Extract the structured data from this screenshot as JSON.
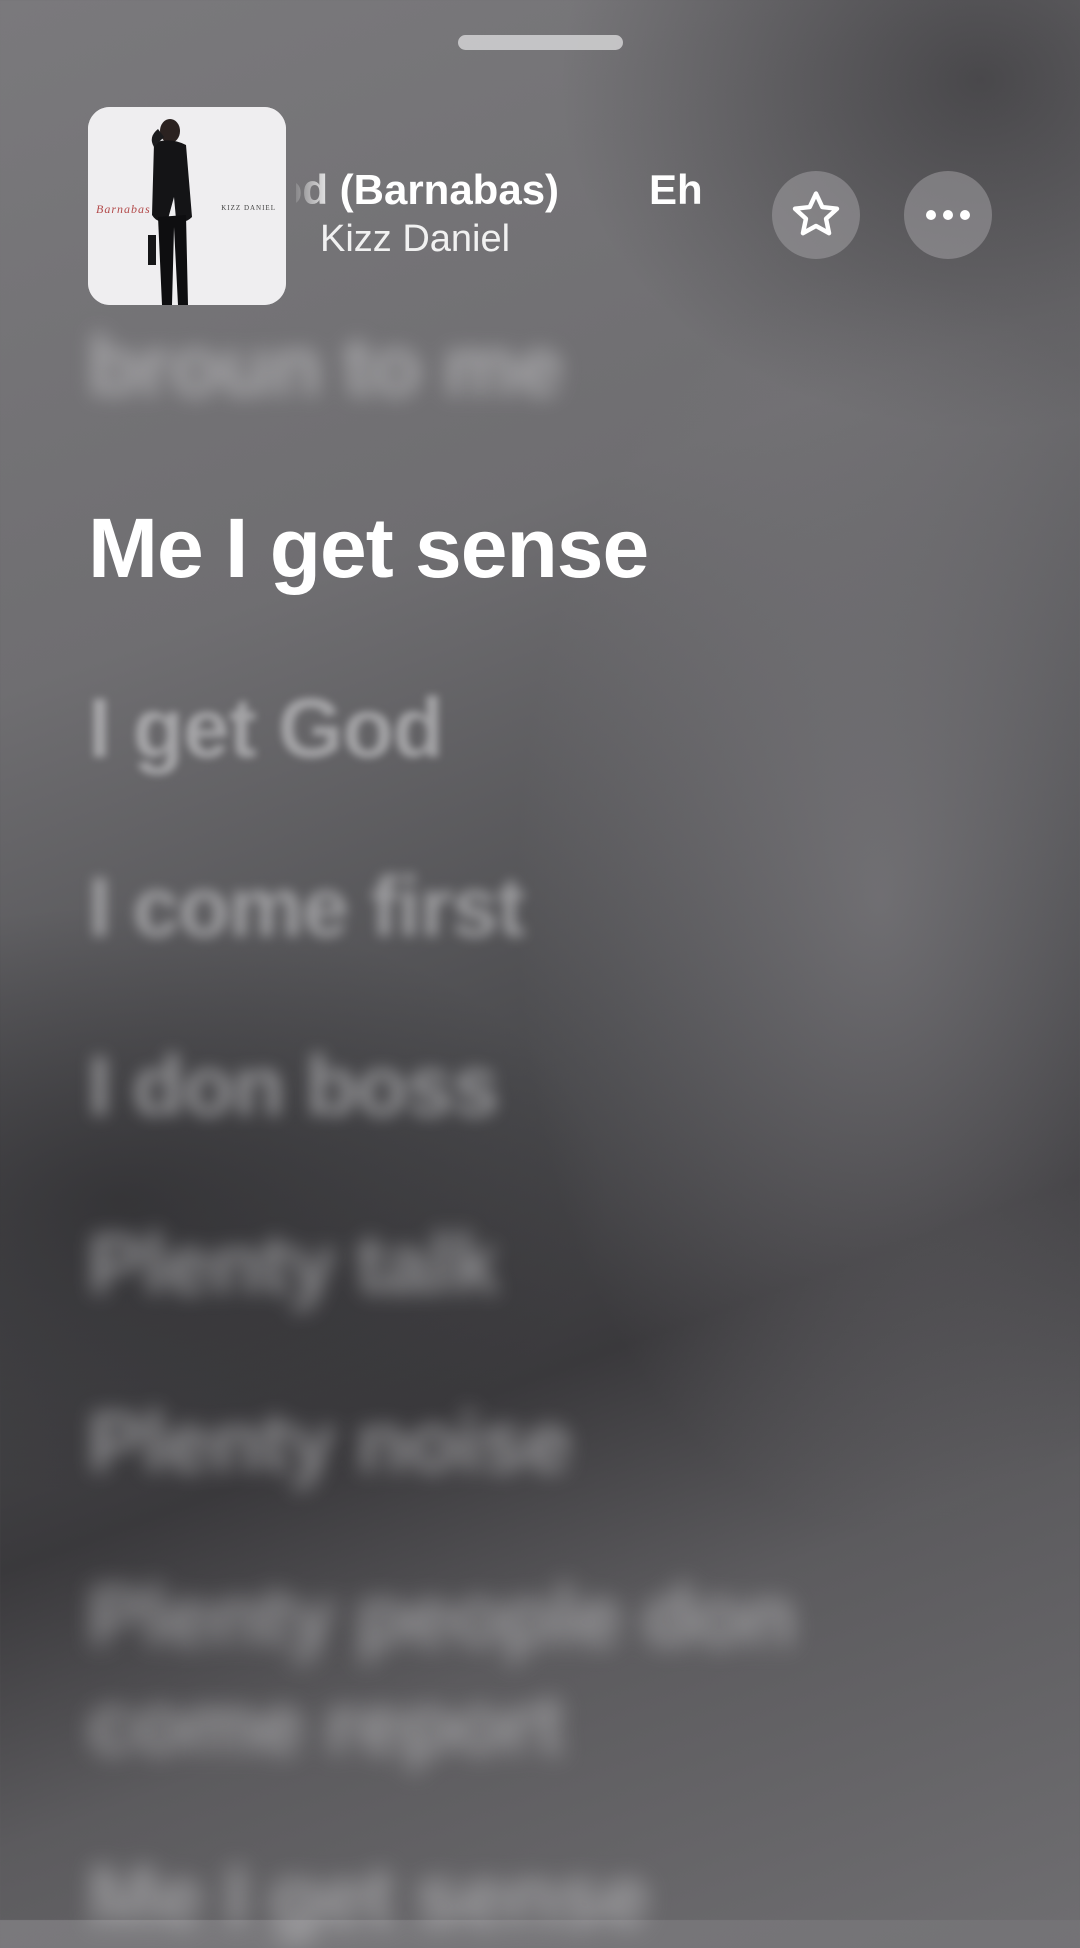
{
  "now_playing": {
    "title_visible": "God (Barnabas)",
    "title_next": "Eh",
    "artist": "Kizz Daniel",
    "artwork": {
      "album_title": "Barnabas",
      "artist_text": "KIZZ DANIEL"
    }
  },
  "actions": {
    "favorite_icon": "star-outline-icon",
    "more_icon": "ellipsis-icon"
  },
  "lyrics": {
    "previous_line": "broun to me",
    "current_line": "Me I get sense",
    "upcoming": [
      "I get God",
      "I come first",
      "I don boss",
      "Plenty talk",
      "Plenty noise",
      "Plenty people don",
      "come report",
      "Me I get sense"
    ]
  }
}
